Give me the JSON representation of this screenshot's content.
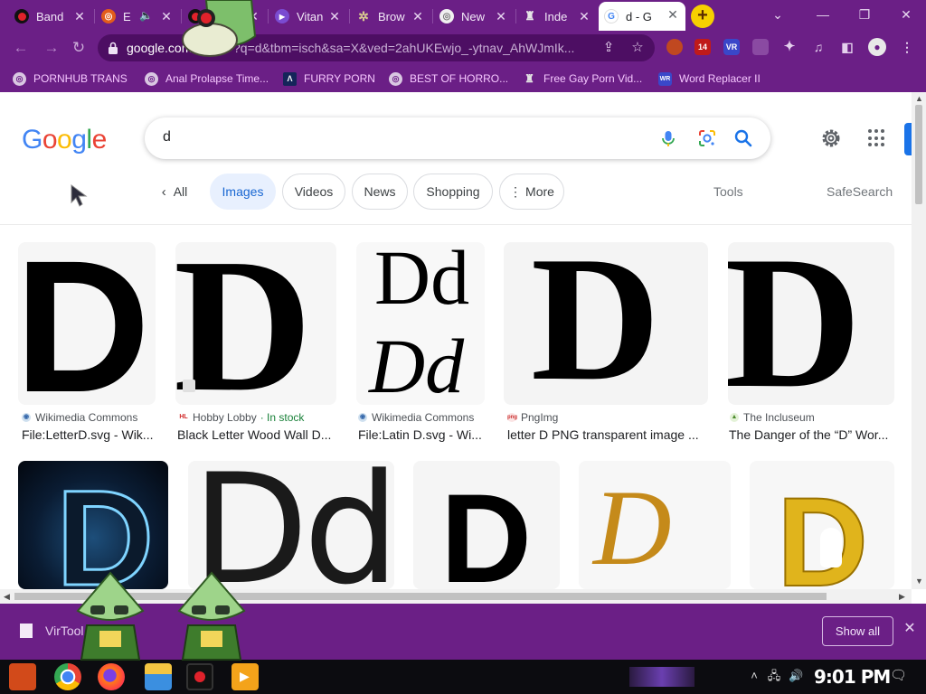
{
  "browser": {
    "tabs": [
      {
        "title": "Band",
        "favicon": "red-record-icon",
        "color": "#e0222b"
      },
      {
        "title": "E",
        "favicon": "chrome-icon",
        "color": "#e25c1b",
        "audio": true
      },
      {
        "title": "",
        "favicon": "red-record-icon",
        "color": "#e0222b"
      },
      {
        "title": "Vitan",
        "favicon": "play-icon",
        "color": "#7a4bd1"
      },
      {
        "title": "Brow",
        "favicon": "gear-icon",
        "color": "#b7a05a"
      },
      {
        "title": "New",
        "favicon": "chrome-icon",
        "color": "#6f6f6f"
      },
      {
        "title": "Inde",
        "favicon": "gem-icon",
        "color": "#9e9e9e"
      },
      {
        "title": "d - G",
        "favicon": "google-icon",
        "color": "#4285f4",
        "active": true
      }
    ],
    "new_tab_label": "+",
    "address": {
      "host": "google.com",
      "path": "/search?q=d&tbm=isch&sa=X&ved=2ahUKEwjo_-ytnav_AhWJmIk...",
      "path_visible": "?q=d&tbm=isch&sa=X&ved=2ahUKEwjo_-ytnav_AhWJmIk..."
    },
    "extensions": [
      {
        "label": "",
        "color": "#c04820"
      },
      {
        "label": "14",
        "color": "#c01a1a"
      },
      {
        "label": "VR",
        "color": "#3a47c9"
      },
      {
        "label": "",
        "color": "#8a4aa2"
      }
    ],
    "bookmarks": [
      {
        "label": "PORNHUB TRANS",
        "icon": "globe-icon"
      },
      {
        "label": "Anal Prolapse Time...",
        "icon": "globe-icon"
      },
      {
        "label": "FURRY PORN",
        "icon": "lambda-icon"
      },
      {
        "label": "BEST OF HORRO...",
        "icon": "globe-icon"
      },
      {
        "label": "Free Gay Porn Vid...",
        "icon": "gem-icon"
      },
      {
        "label": "Word Replacer II",
        "icon": "wr-icon"
      }
    ]
  },
  "google": {
    "logo": [
      "G",
      "o",
      "o",
      "g",
      "l",
      "e"
    ],
    "logo_colors": [
      "#4285f4",
      "#ea4335",
      "#fbbc05",
      "#4285f4",
      "#34a853",
      "#ea4335"
    ],
    "query": "d",
    "chips": [
      {
        "label": "All",
        "back": true
      },
      {
        "label": "Images",
        "selected": true
      },
      {
        "label": "Videos"
      },
      {
        "label": "News"
      },
      {
        "label": "Shopping"
      },
      {
        "label": "More",
        "menu": true
      }
    ],
    "tools_label": "Tools",
    "safesearch_label": "SafeSearch"
  },
  "results": {
    "row1": [
      {
        "glyph": "D",
        "source": "Wikimedia Commons",
        "source_icon": "wikimedia-icon",
        "caption": "File:LetterD.svg - Wik..."
      },
      {
        "glyph": "D",
        "source": "Hobby Lobby",
        "source_icon": "hobby-lobby-icon",
        "stock": "· In stock",
        "caption": "Black Letter Wood Wall D..."
      },
      {
        "glyph": "Dd",
        "glyph2": "Dd",
        "source": "Wikimedia Commons",
        "source_icon": "wikimedia-icon",
        "caption": "File:Latin D.svg - Wi..."
      },
      {
        "glyph": "D",
        "source": "PngImg",
        "source_icon": "png-icon",
        "caption": "letter D PNG transparent image ..."
      },
      {
        "glyph": "D",
        "source": "The Incluseum",
        "source_icon": "incluseum-icon",
        "caption": "The Danger of the “D” Wor..."
      }
    ],
    "row2": [
      {
        "glyph": "D"
      },
      {
        "glyph": "Dd"
      },
      {
        "glyph": "D"
      },
      {
        "glyph": "D"
      },
      {
        "glyph": "D"
      }
    ]
  },
  "download": {
    "filename": "VirTool.Ve...VE",
    "show_all": "Show all"
  },
  "taskbar": {
    "clock": "9:01 PM"
  },
  "colors": {
    "chrome_purple": "#6b1f86",
    "omnibox": "#4d0e63",
    "google_blue": "#1a73e8",
    "gem_green": "#7dbf6b"
  }
}
